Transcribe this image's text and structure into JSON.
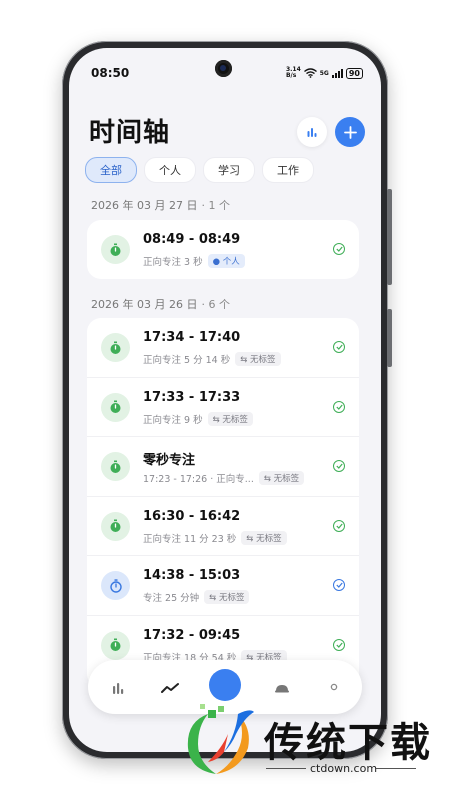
{
  "status_bar": {
    "time": "08:50",
    "net_speed_top": "3.14",
    "net_speed_bottom": "B/s",
    "network": "5G",
    "battery": "90"
  },
  "header": {
    "title": "时间轴"
  },
  "filters": [
    {
      "label": "全部",
      "active": true
    },
    {
      "label": "个人",
      "active": false
    },
    {
      "label": "学习",
      "active": false
    },
    {
      "label": "工作",
      "active": false
    }
  ],
  "groups": [
    {
      "date": "2026 年 03 月 27 日",
      "count": "· 1 个",
      "items": [
        {
          "title": "08:49 - 08:49",
          "subtitle": "正向专注 3 秒",
          "tag": "● 个人",
          "tag_style": "blue",
          "icon": "stopwatch-icon",
          "icon_style": "green"
        }
      ]
    },
    {
      "date": "2026 年 03 月 26 日",
      "count": "· 6 个",
      "items": [
        {
          "title": "17:34 - 17:40",
          "subtitle": "正向专注 5 分 14 秒",
          "tag": "⇆ 无标签",
          "tag_style": "gray",
          "icon": "stopwatch-icon",
          "icon_style": "green"
        },
        {
          "title": "17:33 - 17:33",
          "subtitle": "正向专注 9 秒",
          "tag": "⇆ 无标签",
          "tag_style": "gray",
          "icon": "stopwatch-icon",
          "icon_style": "green"
        },
        {
          "title": "零秒专注",
          "subtitle": "17:23 - 17:26 · 正向专...",
          "tag": "⇆ 无标签",
          "tag_style": "gray",
          "icon": "stopwatch-icon",
          "icon_style": "green"
        },
        {
          "title": "16:30 - 16:42",
          "subtitle": "正向专注 11 分 23 秒",
          "tag": "⇆ 无标签",
          "tag_style": "gray",
          "icon": "stopwatch-icon",
          "icon_style": "green"
        },
        {
          "title": "14:38 - 15:03",
          "subtitle": "专注 25 分钟",
          "tag": "⇆ 无标签",
          "tag_style": "gray",
          "icon": "timer-icon",
          "icon_style": "blue"
        },
        {
          "title": "17:32 - 09:45",
          "subtitle": "正向专注 18 分 54 秒",
          "tag": "⇆ 无标签",
          "tag_style": "gray",
          "icon": "stopwatch-icon",
          "icon_style": "green"
        }
      ]
    }
  ],
  "tabbar": {
    "tabs": [
      "stats-icon",
      "timeline-icon",
      "focus-icon",
      "helmet-icon",
      "profile-icon"
    ]
  },
  "watermark": {
    "text": "传统下载",
    "url": "ctdown.com"
  },
  "colors": {
    "accent": "#3a7ff0",
    "success": "#3fae57",
    "background": "#f4f4f8"
  }
}
